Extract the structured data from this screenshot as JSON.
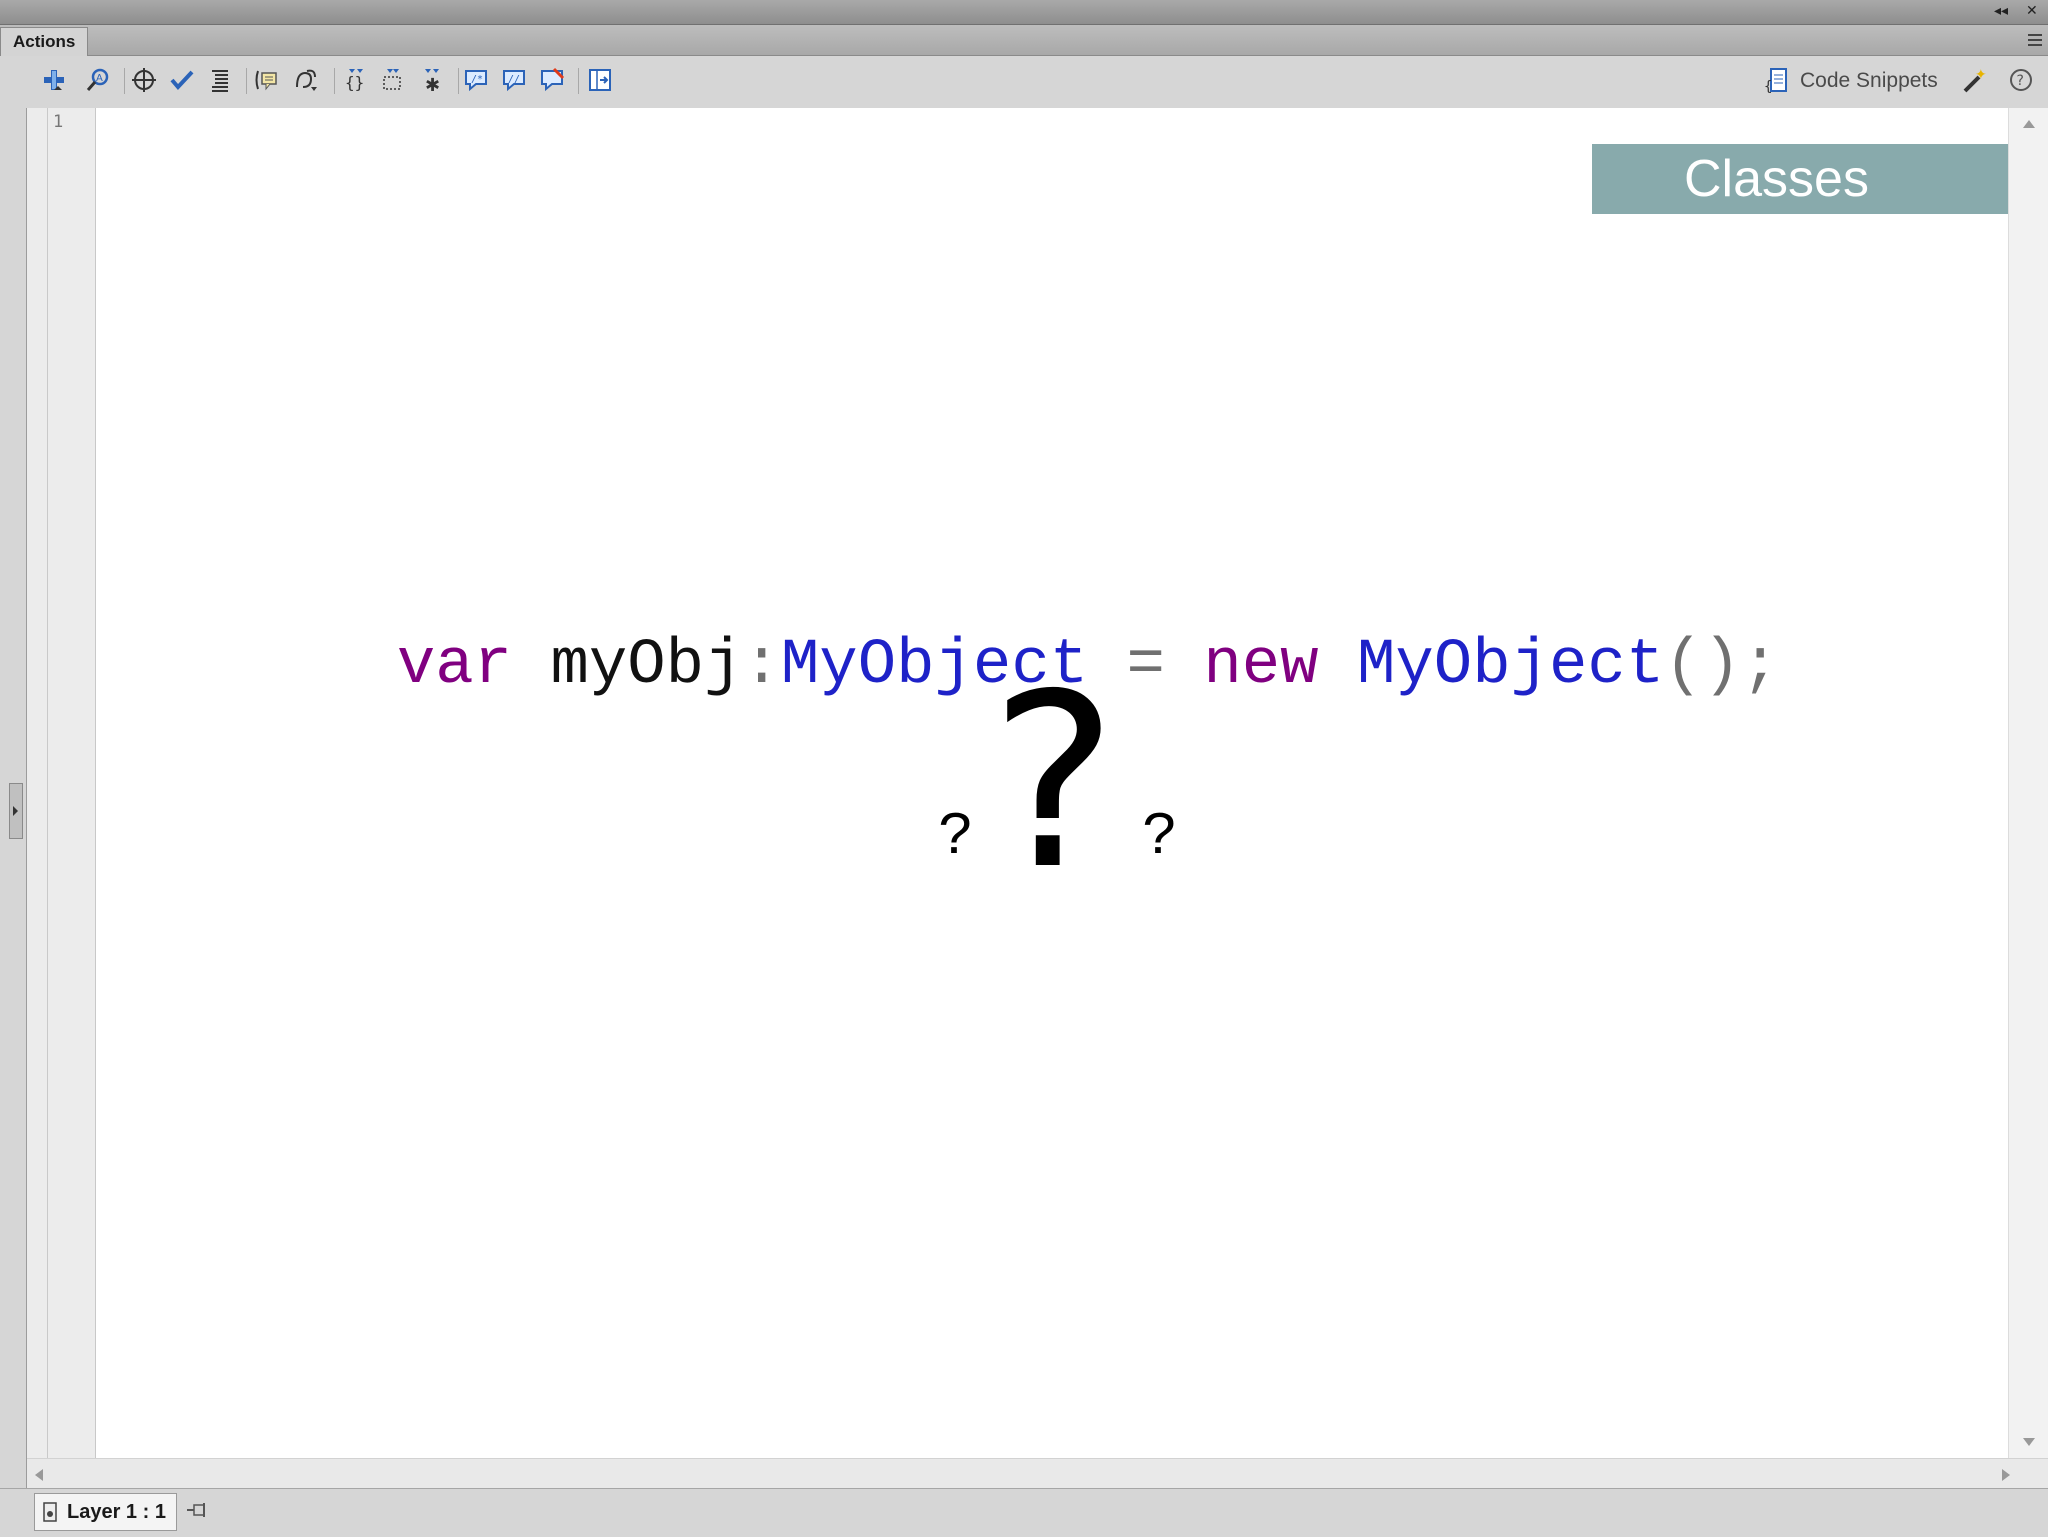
{
  "window": {
    "panel_tab": "Actions",
    "controls": {
      "collapse": "◂◂",
      "close": "✕"
    }
  },
  "toolbar": {
    "tools": [
      "add-item-icon",
      "find-icon",
      "target-icon",
      "check-syntax-icon",
      "auto-format-icon",
      "code-hint-icon",
      "debug-options-icon",
      "collapse-between-braces-icon",
      "collapse-selection-icon",
      "expand-all-icon",
      "block-comment-icon",
      "line-comment-icon",
      "remove-comment-icon",
      "toggle-script-assist-icon"
    ],
    "code_snippets_label": "Code Snippets",
    "help_label": "?"
  },
  "editor": {
    "line_number": "1",
    "banner": "Classes",
    "code_tokens": [
      {
        "text": "var",
        "kind": "kw"
      },
      {
        "text": " ",
        "kind": "id"
      },
      {
        "text": "myObj",
        "kind": "id"
      },
      {
        "text": ":",
        "kind": "op"
      },
      {
        "text": "MyObject",
        "kind": "ty"
      },
      {
        "text": " ",
        "kind": "id"
      },
      {
        "text": "=",
        "kind": "op"
      },
      {
        "text": " ",
        "kind": "id"
      },
      {
        "text": "new",
        "kind": "kw"
      },
      {
        "text": " ",
        "kind": "id"
      },
      {
        "text": "MyObject",
        "kind": "ty"
      },
      {
        "text": "();",
        "kind": "op"
      }
    ],
    "question_big": "?",
    "question_small_left": "?",
    "question_small_right": "?"
  },
  "statusbar": {
    "layer_label": "Layer 1 : 1"
  },
  "colors": {
    "keyword": "#800080",
    "type": "#1e22c8",
    "identifier": "#111111",
    "operator": "#707070",
    "banner": "#88aaac"
  }
}
